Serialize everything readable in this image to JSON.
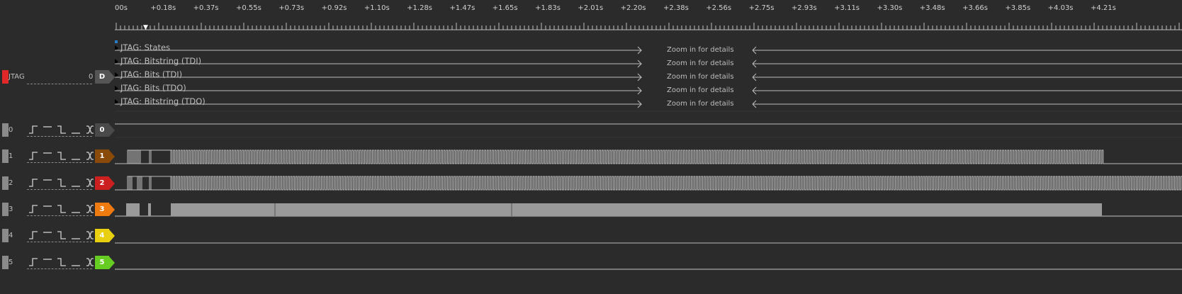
{
  "ruler": {
    "labels": [
      "00s",
      "+0.18s",
      "+0.37s",
      "+0.55s",
      "+0.73s",
      "+0.92s",
      "+1.10s",
      "+1.28s",
      "+1.47s",
      "+1.65s",
      "+1.83s",
      "+2.01s",
      "+2.20s",
      "+2.38s",
      "+2.56s",
      "+2.75s",
      "+2.93s",
      "+3.11s",
      "+3.30s",
      "+3.48s",
      "+3.66s",
      "+3.85s",
      "+4.03s",
      "+4.21s"
    ]
  },
  "analyzer": {
    "name": "JTAG",
    "value": "0",
    "tag": "D",
    "color": "#e02828",
    "rows": [
      {
        "label": "JTAG: States",
        "zoom": "Zoom in for details"
      },
      {
        "label": "JTAG: Bitstring (TDI)",
        "zoom": "Zoom in for details"
      },
      {
        "label": "JTAG: Bits (TDI)",
        "zoom": "Zoom in for details"
      },
      {
        "label": "JTAG: Bits (TDO)",
        "zoom": "Zoom in for details"
      },
      {
        "label": "JTAG: Bitstring (TDO)",
        "zoom": "Zoom in for details"
      }
    ]
  },
  "channels": [
    {
      "name": "0",
      "tag": "0",
      "color": "#4a4a4a"
    },
    {
      "name": "1",
      "tag": "1",
      "color": "#8a4a0a"
    },
    {
      "name": "2",
      "tag": "2",
      "color": "#cc1f1f"
    },
    {
      "name": "3",
      "tag": "3",
      "color": "#ef7a10"
    },
    {
      "name": "4",
      "tag": "4",
      "color": "#e8d010"
    },
    {
      "name": "5",
      "tag": "5",
      "color": "#66cc22"
    }
  ]
}
